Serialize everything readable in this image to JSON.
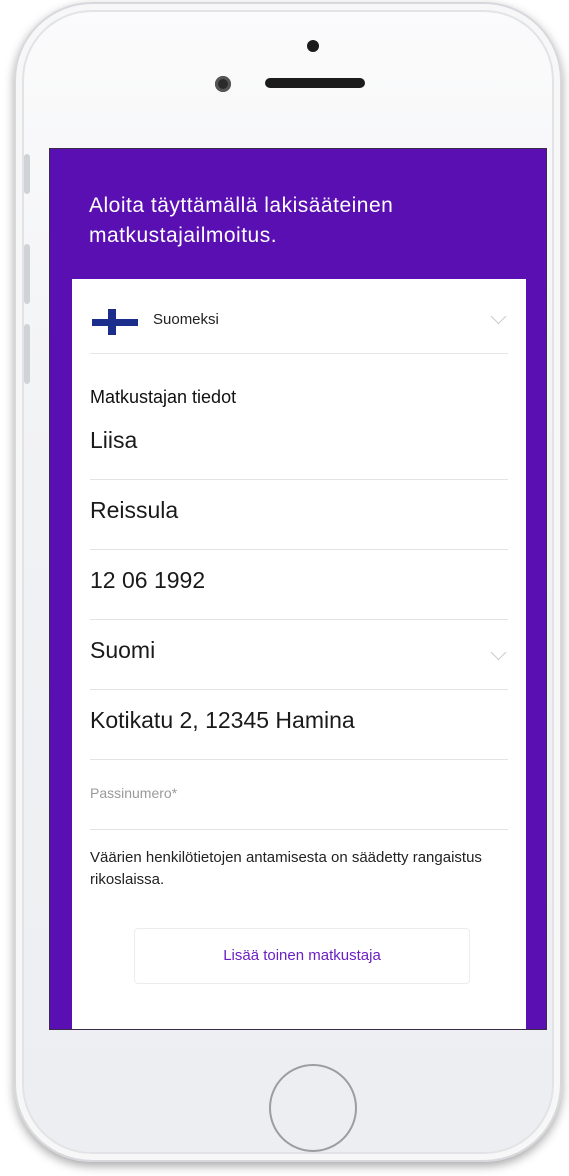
{
  "screen": {
    "header_title": "Aloita täyttämällä lakisääteinen matkustajailmoitus.",
    "language": {
      "label": "Suomeksi",
      "flag_icon": "finland-flag-icon"
    },
    "section_title": "Matkustajan tiedot",
    "fields": {
      "first_name": "Liisa",
      "last_name": "Reissula",
      "birth_date": "12 06 1992",
      "country": "Suomi",
      "address": "Kotikatu 2, 12345 Hamina",
      "passport_placeholder": "Passinumero*"
    },
    "notice": "Väärien henkilötietojen antamisesta on säädetty rangaistus rikoslaissa.",
    "add_traveler_button": "Lisää toinen matkustaja"
  },
  "colors": {
    "brand_purple": "#5a0fb3",
    "link_purple": "#6a1fc4"
  }
}
